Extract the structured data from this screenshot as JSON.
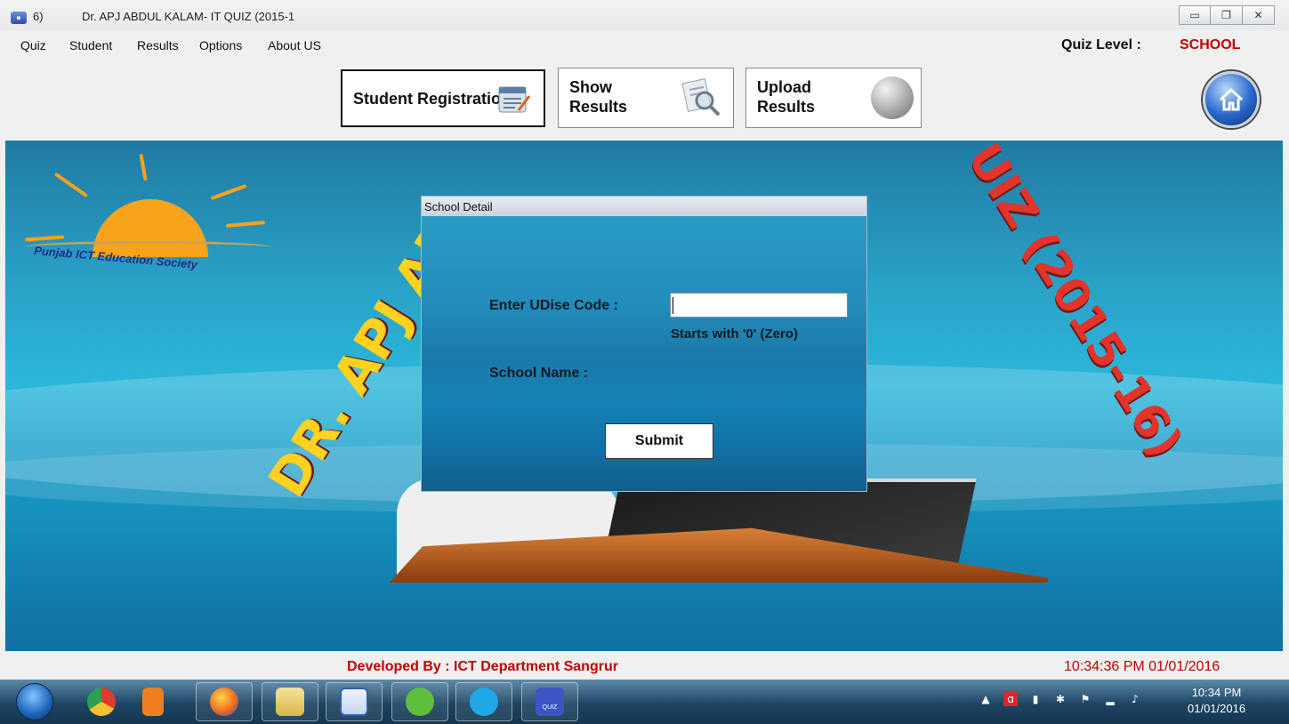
{
  "window": {
    "title_prefix": "6)",
    "title": "Dr. APJ ABDUL KALAM-  IT QUIZ (2015-1",
    "minimize_glyph": "▭",
    "restore_glyph": "❐",
    "close_glyph": "✕"
  },
  "menu": {
    "items": [
      "Quiz",
      "Student",
      "Results",
      "Options",
      "About US"
    ],
    "quiz_level_label": "Quiz Level :",
    "quiz_level_value": "SCHOOL"
  },
  "toolbar": {
    "student_registration": "Student Registration",
    "show_results_line1": "Show",
    "show_results_line2": "Results",
    "upload_results_line1": "Upload",
    "upload_results_line2": "Results",
    "home_icon": "home-icon"
  },
  "banner": {
    "logo_text": "Punjab ICT Education Society",
    "arc_left": "DR. APJ AB",
    "arc_right": "UIZ (2015-16)"
  },
  "dialog": {
    "title": "School Detail",
    "udise_label": "Enter UDise Code :",
    "udise_value": "",
    "udise_hint": "Starts with '0' (Zero)",
    "school_name_label": "School Name :",
    "submit_label": "Submit"
  },
  "footer": {
    "developed_by": "Developed By :  ICT Department Sangrur",
    "clock": "10:34:36 PM   01/01/2016"
  },
  "taskbar": {
    "apps": [
      "chrome",
      "media-player",
      "firefox",
      "file-explorer",
      "word",
      "utorrent",
      "skype",
      "quiz"
    ],
    "quiz_icon_label": "QUIZ",
    "time": "10:34 PM",
    "date": "01/01/2016",
    "colors": {
      "accent_red": "#c00000"
    }
  }
}
